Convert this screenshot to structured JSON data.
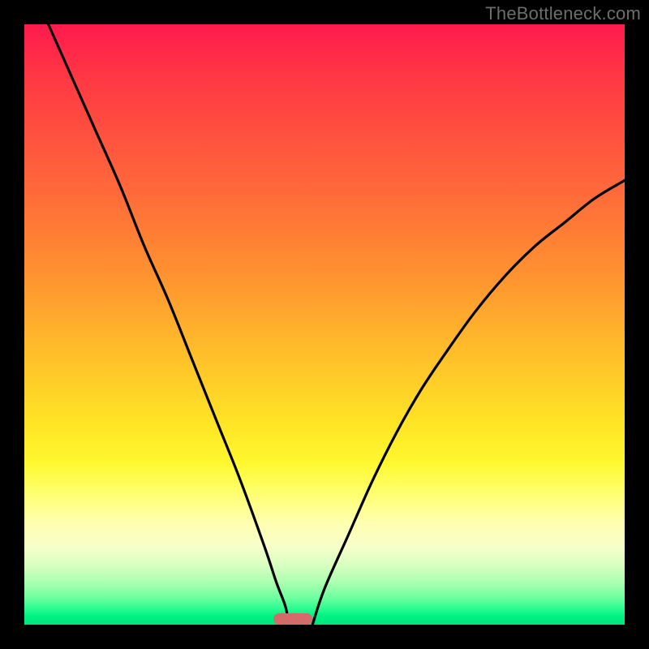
{
  "watermark": "TheBottleneck.com",
  "chart_data": {
    "type": "line",
    "title": "",
    "xlabel": "",
    "ylabel": "",
    "xlim": [
      0,
      100
    ],
    "ylim": [
      0,
      100
    ],
    "grid": false,
    "legend": false,
    "background_gradient": {
      "direction": "vertical",
      "stops": [
        {
          "pos": 0.0,
          "color": "#ff1a4d",
          "meaning": "severe-bottleneck"
        },
        {
          "pos": 0.5,
          "color": "#ffbf2a",
          "meaning": "moderate"
        },
        {
          "pos": 0.78,
          "color": "#ffff6e",
          "meaning": "mild"
        },
        {
          "pos": 0.97,
          "color": "#2bfc90",
          "meaning": "optimal"
        },
        {
          "pos": 1.0,
          "color": "#00e57c",
          "meaning": "optimal"
        }
      ]
    },
    "optimal_x": 44,
    "marker": {
      "x_start": 41.5,
      "x_end": 48,
      "color": "#d46a6a"
    },
    "series": [
      {
        "name": "left-curve",
        "x": [
          4,
          8,
          12,
          16,
          20,
          24,
          28,
          32,
          36,
          40,
          42,
          43.5,
          44
        ],
        "values": [
          100,
          91,
          82,
          73,
          63,
          54,
          44,
          34,
          24,
          13,
          7,
          3,
          0
        ]
      },
      {
        "name": "right-curve",
        "x": [
          48,
          50,
          54,
          58,
          62,
          66,
          70,
          75,
          80,
          85,
          90,
          95,
          100
        ],
        "values": [
          0,
          6,
          15,
          24,
          32,
          39,
          45,
          52,
          58,
          63,
          67,
          71,
          74
        ]
      }
    ]
  }
}
